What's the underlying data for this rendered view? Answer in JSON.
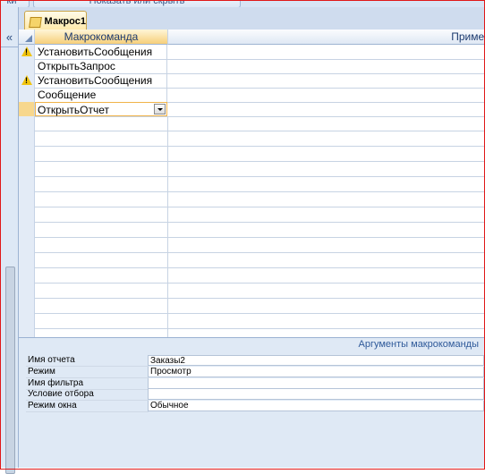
{
  "top_strip": {
    "left_button": "ки",
    "right_button": "Показать или скрыть"
  },
  "nav": {
    "collapse_glyph": "«"
  },
  "tab": {
    "label": "Макрос1"
  },
  "grid": {
    "columns": {
      "action": "Макрокоманда",
      "note": "Примеч"
    },
    "rows": [
      {
        "action": "УстановитьСообщения",
        "note": "",
        "warning": true
      },
      {
        "action": "ОткрытьЗапрос",
        "note": "",
        "warning": false
      },
      {
        "action": "УстановитьСообщения",
        "note": "",
        "warning": true
      },
      {
        "action": "Сообщение",
        "note": "",
        "warning": false
      },
      {
        "action": "ОткрытьОтчет",
        "note": "",
        "warning": false,
        "current": true
      }
    ]
  },
  "arguments": {
    "title": "Аргументы макрокоманды",
    "rows": [
      {
        "label": "Имя отчета",
        "value": "Заказы2"
      },
      {
        "label": "Режим",
        "value": "Просмотр"
      },
      {
        "label": "Имя фильтра",
        "value": ""
      },
      {
        "label": "Условие отбора",
        "value": ""
      },
      {
        "label": "Режим окна",
        "value": "Обычное"
      }
    ]
  },
  "colors": {
    "frame": "#e01818",
    "accent": "#f6cf7a",
    "warning": "#f1c40f"
  }
}
